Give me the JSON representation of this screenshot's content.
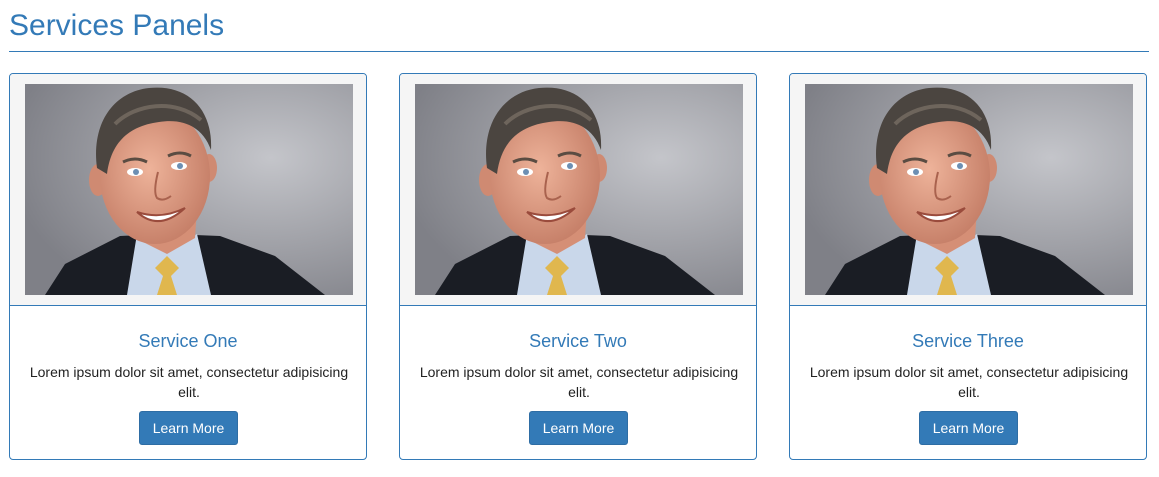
{
  "header": {
    "title": "Services Panels"
  },
  "colors": {
    "accent": "#337ab7",
    "heading_bg": "#f5f5f5",
    "text": "#222222"
  },
  "services": [
    {
      "title": "Service One",
      "text": "Lorem ipsum dolor sit amet, consectetur adipisicing elit.",
      "button_label": "Learn More",
      "image": "portrait-photo"
    },
    {
      "title": "Service Two",
      "text": "Lorem ipsum dolor sit amet, consectetur adipisicing elit.",
      "button_label": "Learn More",
      "image": "portrait-photo"
    },
    {
      "title": "Service Three",
      "text": "Lorem ipsum dolor sit amet, consectetur adipisicing elit.",
      "button_label": "Learn More",
      "image": "portrait-photo"
    }
  ]
}
